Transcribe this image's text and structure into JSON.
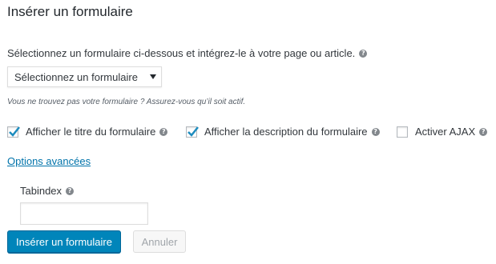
{
  "dialog": {
    "title": "Insérer un formulaire"
  },
  "form_select": {
    "intro_text": "Sélectionnez un formulaire ci-dessous et intégrez-le à votre page ou article.",
    "selected_value": "Sélectionnez un formulaire",
    "inactive_note": "Vous ne trouvez pas votre formulaire ? Assurez-vous qu’il soit actif."
  },
  "options": [
    {
      "label": "Afficher le titre du formulaire",
      "checked": true
    },
    {
      "label": "Afficher la description du formulaire",
      "checked": true
    },
    {
      "label": "Activer AJAX",
      "checked": false
    }
  ],
  "advanced": {
    "link_label": "Options avancées",
    "tabindex_label": "Tabindex",
    "tabindex_value": ""
  },
  "buttons": {
    "insert_label": "Insérer un formulaire",
    "cancel_label": "Annuler"
  },
  "icons": {
    "help": "help-icon",
    "checkmark": "checkmark-icon",
    "dropdown": "chevron-down-icon"
  },
  "colors": {
    "primary_button": "#0085ba",
    "link": "#0073aa",
    "checkmark": "#1e8cbe"
  }
}
